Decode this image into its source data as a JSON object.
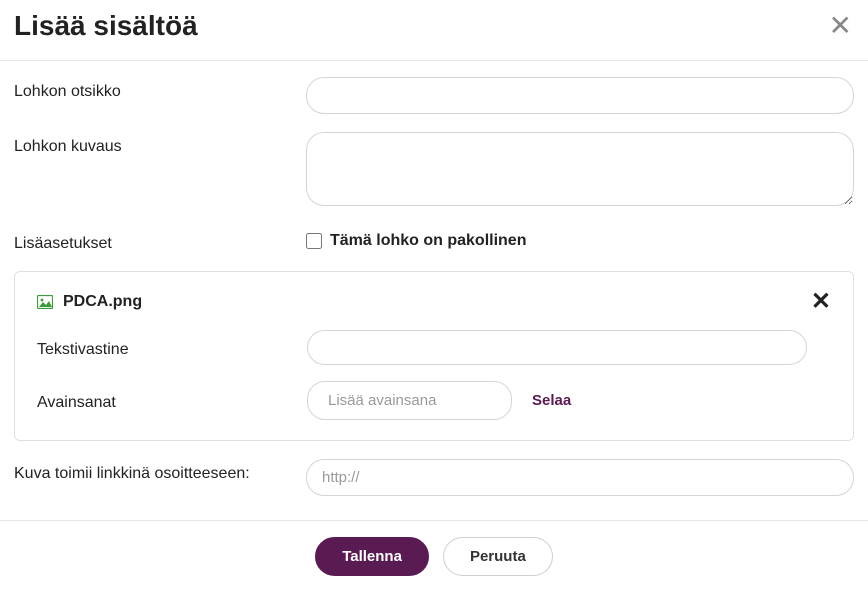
{
  "modal": {
    "title": "Lisää sisältöä"
  },
  "form": {
    "block_title_label": "Lohkon otsikko",
    "block_title_value": "",
    "block_desc_label": "Lohkon kuvaus",
    "block_desc_value": "",
    "extra_settings_label": "Lisäasetukset",
    "required_label": "Tämä lohko on pakollinen",
    "required_checked": false,
    "image_link_label": "Kuva toimii linkkinä osoitteeseen:",
    "image_link_value": "",
    "image_link_placeholder": "http://"
  },
  "file": {
    "name": "PDCA.png",
    "alt_label": "Tekstivastine",
    "alt_value": "",
    "keywords_label": "Avainsanat",
    "keywords_placeholder": "Lisää avainsana",
    "keywords_value": "",
    "browse_label": "Selaa"
  },
  "footer": {
    "save": "Tallenna",
    "cancel": "Peruuta"
  }
}
